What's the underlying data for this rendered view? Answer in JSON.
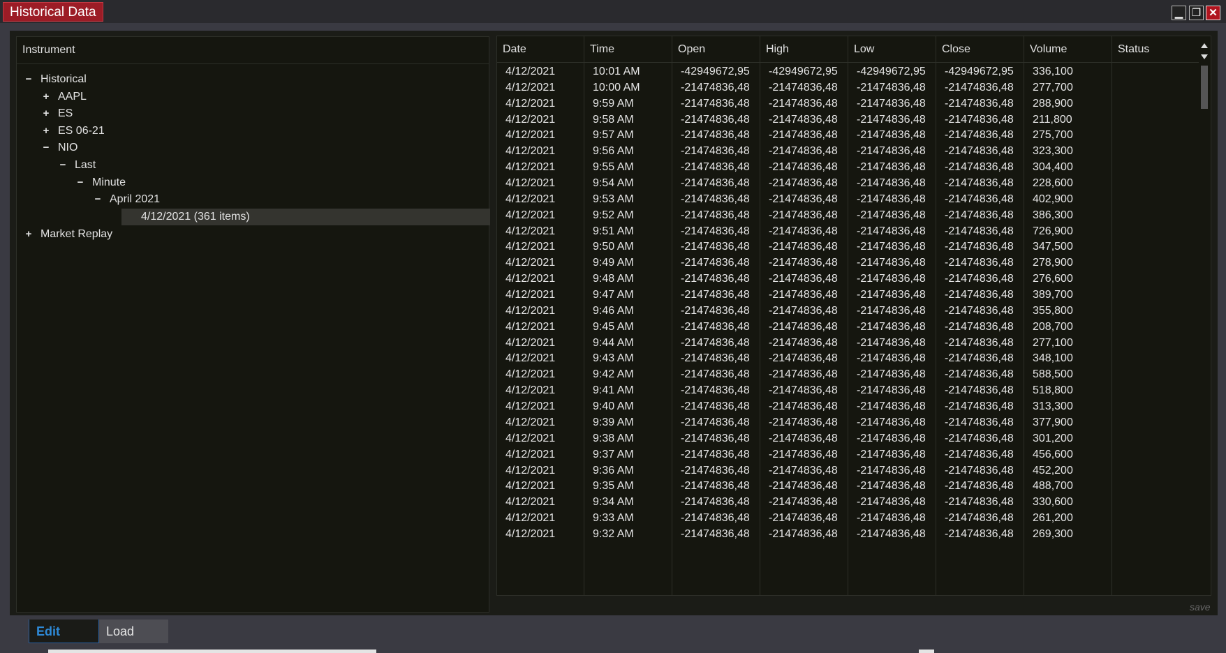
{
  "window": {
    "title": "Historical Data",
    "minimize": "▁",
    "restore": "❐",
    "close": "✕"
  },
  "tree": {
    "header": "Instrument",
    "nodes": [
      {
        "label": "Historical",
        "toggle": "−",
        "depth": 0
      },
      {
        "label": "AAPL",
        "toggle": "+",
        "depth": 1
      },
      {
        "label": "ES",
        "toggle": "+",
        "depth": 1
      },
      {
        "label": "ES 06-21",
        "toggle": "+",
        "depth": 1
      },
      {
        "label": "NIO",
        "toggle": "−",
        "depth": 1
      },
      {
        "label": "Last",
        "toggle": "−",
        "depth": 2
      },
      {
        "label": "Minute",
        "toggle": "−",
        "depth": 3
      },
      {
        "label": "April 2021",
        "toggle": "−",
        "depth": 4
      },
      {
        "label": "4/12/2021 (361 items)",
        "toggle": "",
        "depth": 5,
        "selected": true
      },
      {
        "label": "Market Replay",
        "toggle": "+",
        "depth": 0
      }
    ]
  },
  "grid": {
    "columns": [
      "Date",
      "Time",
      "Open",
      "High",
      "Low",
      "Close",
      "Volume",
      "Status"
    ],
    "rows": [
      [
        "4/12/2021",
        "10:01 AM",
        "-42949672,95",
        "-42949672,95",
        "-42949672,95",
        "-42949672,95",
        "336,100",
        ""
      ],
      [
        "4/12/2021",
        "10:00 AM",
        "-21474836,48",
        "-21474836,48",
        "-21474836,48",
        "-21474836,48",
        "277,700",
        ""
      ],
      [
        "4/12/2021",
        "9:59 AM",
        "-21474836,48",
        "-21474836,48",
        "-21474836,48",
        "-21474836,48",
        "288,900",
        ""
      ],
      [
        "4/12/2021",
        "9:58 AM",
        "-21474836,48",
        "-21474836,48",
        "-21474836,48",
        "-21474836,48",
        "211,800",
        ""
      ],
      [
        "4/12/2021",
        "9:57 AM",
        "-21474836,48",
        "-21474836,48",
        "-21474836,48",
        "-21474836,48",
        "275,700",
        ""
      ],
      [
        "4/12/2021",
        "9:56 AM",
        "-21474836,48",
        "-21474836,48",
        "-21474836,48",
        "-21474836,48",
        "323,300",
        ""
      ],
      [
        "4/12/2021",
        "9:55 AM",
        "-21474836,48",
        "-21474836,48",
        "-21474836,48",
        "-21474836,48",
        "304,400",
        ""
      ],
      [
        "4/12/2021",
        "9:54 AM",
        "-21474836,48",
        "-21474836,48",
        "-21474836,48",
        "-21474836,48",
        "228,600",
        ""
      ],
      [
        "4/12/2021",
        "9:53 AM",
        "-21474836,48",
        "-21474836,48",
        "-21474836,48",
        "-21474836,48",
        "402,900",
        ""
      ],
      [
        "4/12/2021",
        "9:52 AM",
        "-21474836,48",
        "-21474836,48",
        "-21474836,48",
        "-21474836,48",
        "386,300",
        ""
      ],
      [
        "4/12/2021",
        "9:51 AM",
        "-21474836,48",
        "-21474836,48",
        "-21474836,48",
        "-21474836,48",
        "726,900",
        ""
      ],
      [
        "4/12/2021",
        "9:50 AM",
        "-21474836,48",
        "-21474836,48",
        "-21474836,48",
        "-21474836,48",
        "347,500",
        ""
      ],
      [
        "4/12/2021",
        "9:49 AM",
        "-21474836,48",
        "-21474836,48",
        "-21474836,48",
        "-21474836,48",
        "278,900",
        ""
      ],
      [
        "4/12/2021",
        "9:48 AM",
        "-21474836,48",
        "-21474836,48",
        "-21474836,48",
        "-21474836,48",
        "276,600",
        ""
      ],
      [
        "4/12/2021",
        "9:47 AM",
        "-21474836,48",
        "-21474836,48",
        "-21474836,48",
        "-21474836,48",
        "389,700",
        ""
      ],
      [
        "4/12/2021",
        "9:46 AM",
        "-21474836,48",
        "-21474836,48",
        "-21474836,48",
        "-21474836,48",
        "355,800",
        ""
      ],
      [
        "4/12/2021",
        "9:45 AM",
        "-21474836,48",
        "-21474836,48",
        "-21474836,48",
        "-21474836,48",
        "208,700",
        ""
      ],
      [
        "4/12/2021",
        "9:44 AM",
        "-21474836,48",
        "-21474836,48",
        "-21474836,48",
        "-21474836,48",
        "277,100",
        ""
      ],
      [
        "4/12/2021",
        "9:43 AM",
        "-21474836,48",
        "-21474836,48",
        "-21474836,48",
        "-21474836,48",
        "348,100",
        ""
      ],
      [
        "4/12/2021",
        "9:42 AM",
        "-21474836,48",
        "-21474836,48",
        "-21474836,48",
        "-21474836,48",
        "588,500",
        ""
      ],
      [
        "4/12/2021",
        "9:41 AM",
        "-21474836,48",
        "-21474836,48",
        "-21474836,48",
        "-21474836,48",
        "518,800",
        ""
      ],
      [
        "4/12/2021",
        "9:40 AM",
        "-21474836,48",
        "-21474836,48",
        "-21474836,48",
        "-21474836,48",
        "313,300",
        ""
      ],
      [
        "4/12/2021",
        "9:39 AM",
        "-21474836,48",
        "-21474836,48",
        "-21474836,48",
        "-21474836,48",
        "377,900",
        ""
      ],
      [
        "4/12/2021",
        "9:38 AM",
        "-21474836,48",
        "-21474836,48",
        "-21474836,48",
        "-21474836,48",
        "301,200",
        ""
      ],
      [
        "4/12/2021",
        "9:37 AM",
        "-21474836,48",
        "-21474836,48",
        "-21474836,48",
        "-21474836,48",
        "456,600",
        ""
      ],
      [
        "4/12/2021",
        "9:36 AM",
        "-21474836,48",
        "-21474836,48",
        "-21474836,48",
        "-21474836,48",
        "452,200",
        ""
      ],
      [
        "4/12/2021",
        "9:35 AM",
        "-21474836,48",
        "-21474836,48",
        "-21474836,48",
        "-21474836,48",
        "488,700",
        ""
      ],
      [
        "4/12/2021",
        "9:34 AM",
        "-21474836,48",
        "-21474836,48",
        "-21474836,48",
        "-21474836,48",
        "330,600",
        ""
      ],
      [
        "4/12/2021",
        "9:33 AM",
        "-21474836,48",
        "-21474836,48",
        "-21474836,48",
        "-21474836,48",
        "261,200",
        ""
      ],
      [
        "4/12/2021",
        "9:32 AM",
        "-21474836,48",
        "-21474836,48",
        "-21474836,48",
        "-21474836,48",
        "269,300",
        ""
      ]
    ]
  },
  "footer": {
    "save_link": "save",
    "tabs": [
      {
        "label": "Edit",
        "active": true
      },
      {
        "label": "Load",
        "active": false
      }
    ]
  },
  "colors": {
    "title_accent": "#9c1c26",
    "active_tab_text": "#2e8ad8",
    "grid_bg": "#15160f"
  }
}
